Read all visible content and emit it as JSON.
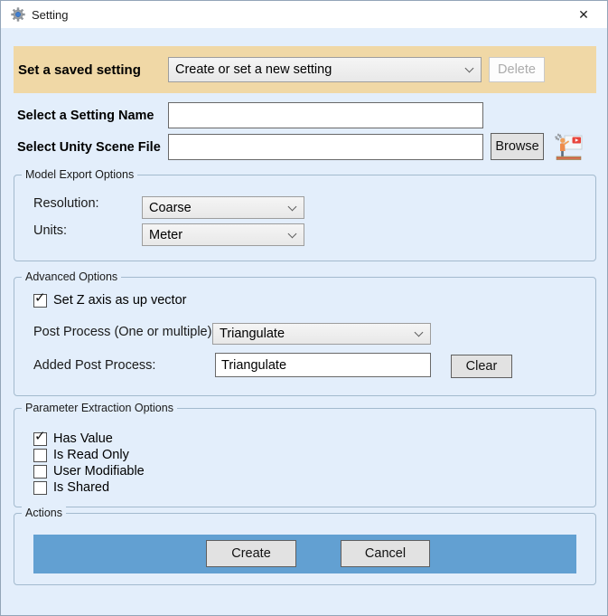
{
  "window": {
    "title": "Setting"
  },
  "banner": {
    "label": "Set a saved setting",
    "combo_value": "Create or set a new setting",
    "delete_label": "Delete"
  },
  "name_row": {
    "label": "Select a Setting Name",
    "value": ""
  },
  "scene_row": {
    "label": "Select Unity Scene File",
    "value": "",
    "browse_label": "Browse"
  },
  "model_export": {
    "title": "Model Export Options",
    "resolution_label": "Resolution:",
    "resolution_value": "Coarse",
    "units_label": "Units:",
    "units_value": "Meter"
  },
  "advanced": {
    "title": "Advanced Options",
    "z_up_label": "Set Z axis as up vector",
    "z_up_checked": true,
    "post_process_label": "Post Process (One or multiple):",
    "post_process_value": "Triangulate",
    "added_label": "Added Post Process:",
    "added_value": "Triangulate",
    "clear_label": "Clear"
  },
  "parameter_extraction": {
    "title": "Parameter Extraction Options",
    "checkboxes": [
      {
        "label": "Has Value",
        "checked": true
      },
      {
        "label": "Is Read Only",
        "checked": false
      },
      {
        "label": "User Modifiable",
        "checked": false
      },
      {
        "label": "Is Shared",
        "checked": false
      }
    ]
  },
  "actions": {
    "title": "Actions",
    "create_label": "Create",
    "cancel_label": "Cancel"
  },
  "icons": {
    "check": "✓",
    "close": "✕"
  },
  "colors": {
    "banner_bg": "#f0d8a6",
    "window_bg": "#e3eefb",
    "action_bar_bg": "#62a0d2",
    "titlebar_bg": "#ffffff"
  }
}
